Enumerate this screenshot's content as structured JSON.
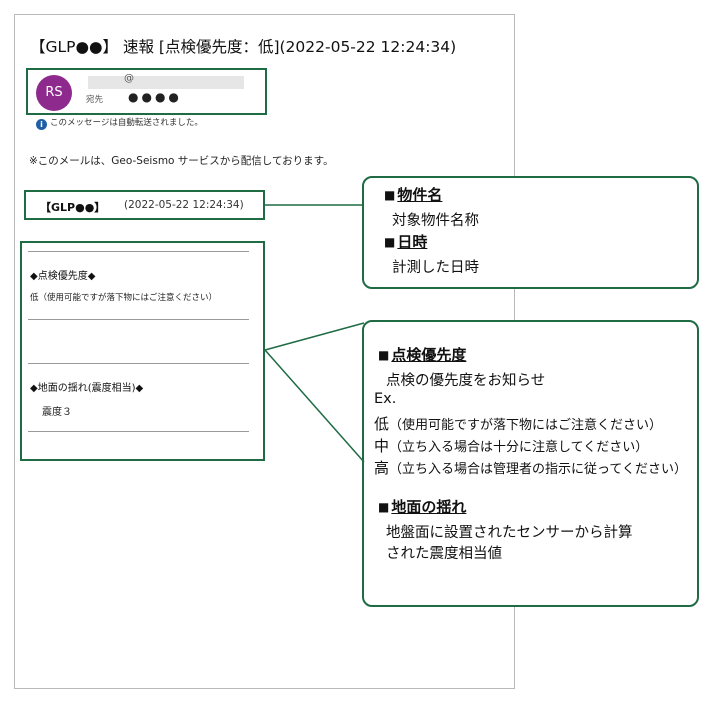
{
  "email": {
    "subject": "【GLP●●】 速報 [点検優先度：低](2022-05-22 12:24:34)",
    "avatar_initials": "RS",
    "sender_email_fragment": "@",
    "to_label": "宛先",
    "to_value": "●●●●",
    "forward_note": "このメッセージは自動転送されました。",
    "delivery_note": "※このメールは、Geo-Seismo サービスから配信しております。",
    "title_bracket": "【GLP●●】",
    "title_date": "(2022-05-22 12:24:34)",
    "priority_label": "◆点検優先度◆",
    "priority_value": "低（使用可能ですが落下物にはご注意ください）",
    "shaking_label": "◆地面の揺れ(震度相当)◆",
    "shaking_value": "震度３"
  },
  "callout_top": {
    "square": "■",
    "heading1": "物件名",
    "desc1": "対象物件名称",
    "heading2": "日時",
    "desc2": "計測した日時"
  },
  "callout_bottom": {
    "square": "■",
    "heading1": "点検優先度",
    "desc1": "点検の優先度をお知らせ",
    "ex_label": "Ex.",
    "examples": [
      {
        "level": "低",
        "text": "（使用可能ですが落下物にはご注意ください）"
      },
      {
        "level": "中",
        "text": "（立ち入る場合は十分に注意してください）"
      },
      {
        "level": "高",
        "text": "（立ち入る場合は管理者の指示に従ってください）"
      }
    ],
    "heading2": "地面の揺れ",
    "desc2_line1": "地盤面に設置されたセンサーから計算",
    "desc2_line2": "された震度相当値"
  },
  "colors": {
    "frame_green": "#1f6b44",
    "avatar_purple": "#8e2a8e",
    "info_blue": "#1f5fa8"
  }
}
